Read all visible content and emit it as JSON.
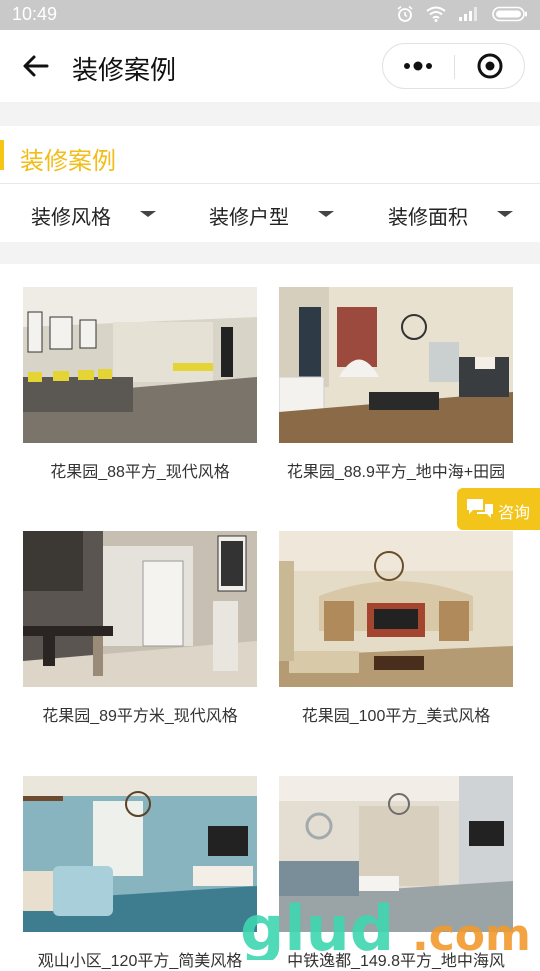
{
  "status_bar": {
    "time": "10:49"
  },
  "nav": {
    "title": "装修案例"
  },
  "section": {
    "title": "装修案例"
  },
  "filters": [
    {
      "label": "装修风格"
    },
    {
      "label": "装修户型"
    },
    {
      "label": "装修面积"
    }
  ],
  "cases": [
    {
      "caption": "花果园_88平方_现代风格"
    },
    {
      "caption": "花果园_88.9平方_地中海+田园"
    },
    {
      "caption": "花果园_89平方米_现代风格"
    },
    {
      "caption": "花果园_100平方_美式风格"
    },
    {
      "caption": "观山小区_120平方_简美风格"
    },
    {
      "caption": "中铁逸都_149.8平方_地中海风"
    }
  ],
  "consult": {
    "label": "咨询"
  },
  "watermark": {
    "text": "glud.com"
  },
  "colors": {
    "accent": "#f3c41a",
    "status_bar": "#c9c9c9"
  }
}
